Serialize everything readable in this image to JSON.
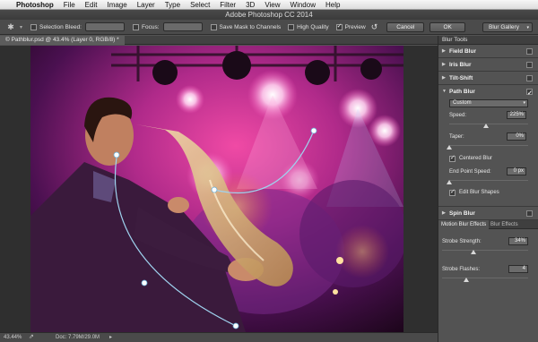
{
  "menubar": {
    "app": "Photoshop",
    "items": [
      "File",
      "Edit",
      "Image",
      "Layer",
      "Type",
      "Select",
      "Filter",
      "3D",
      "View",
      "Window",
      "Help"
    ]
  },
  "window_title": "Adobe Photoshop CC 2014",
  "options": {
    "selection_bleed_label": "Selection Bleed:",
    "focus_label": "Focus:",
    "save_mask_label": "Save Mask to Channels",
    "high_quality_label": "High Quality",
    "preview_label": "Preview",
    "cancel_label": "Cancel",
    "ok_label": "OK",
    "workspace_label": "Blur Gallery"
  },
  "document_tab": "© Pathblur.psd @ 43.4% (Layer 0, RGB/8) *",
  "status": {
    "zoom": "43.44%",
    "doc": "Doc: 7.79M/29.0M"
  },
  "panel": {
    "title": "Blur Tools",
    "sections": [
      "Field Blur",
      "Iris Blur",
      "Tilt-Shift",
      "Path Blur",
      "Spin Blur"
    ],
    "path_blur": {
      "preset": "Custom",
      "speed_label": "Speed:",
      "speed_value": "225%",
      "taper_label": "Taper:",
      "taper_value": "0%",
      "centered_blur_label": "Centered Blur",
      "end_point_speed_label": "End Point Speed:",
      "end_point_speed_value": "0 px",
      "edit_blur_shapes_label": "Edit Blur Shapes"
    },
    "effects_tabs": [
      "Motion Blur Effects",
      "Blur Effects"
    ],
    "strobe_strength_label": "Strobe Strength:",
    "strobe_strength_value": "34%",
    "strobe_flashes_label": "Strobe Flashes:",
    "strobe_flashes_value": "4"
  }
}
